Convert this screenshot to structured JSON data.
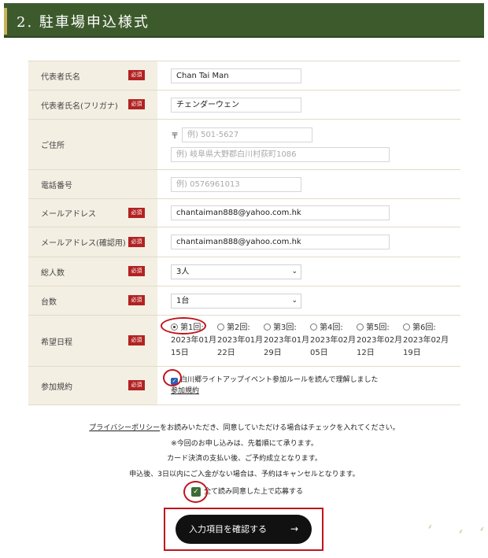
{
  "header": {
    "title": "2. 駐車場申込様式"
  },
  "required_badge": "必須",
  "rows": {
    "name": {
      "label": "代表者氏名",
      "value": "Chan Tai Man"
    },
    "furigana": {
      "label": "代表者氏名(フリガナ)",
      "value": "チェンダーウェン"
    },
    "address": {
      "label": "ご住所",
      "zip_mark": "〒",
      "zip_placeholder": "例) 501-5627",
      "addr_placeholder": "例) 岐阜県大野郡白川村荻町1086"
    },
    "phone": {
      "label": "電話番号",
      "placeholder": "例) 0576961013"
    },
    "email": {
      "label": "メールアドレス",
      "value": "chantaiman888@yahoo.com.hk"
    },
    "email_confirm": {
      "label": "メールアドレス(確認用)",
      "value": "chantaiman888@yahoo.com.hk"
    },
    "people": {
      "label": "総人数",
      "value": "3人"
    },
    "cars": {
      "label": "台数",
      "value": "1台"
    },
    "schedule": {
      "label": "希望日程",
      "options": [
        {
          "label": "第1回:",
          "date1": "2023年01月",
          "date2": "15日",
          "selected": true
        },
        {
          "label": "第2回:",
          "date1": "2023年01月",
          "date2": "22日",
          "selected": false
        },
        {
          "label": "第3回:",
          "date1": "2023年01月",
          "date2": "29日",
          "selected": false
        },
        {
          "label": "第4回:",
          "date1": "2023年02月",
          "date2": "05日",
          "selected": false
        },
        {
          "label": "第5回:",
          "date1": "2023年02月",
          "date2": "12日",
          "selected": false
        },
        {
          "label": "第6回:",
          "date1": "2023年02月",
          "date2": "19日",
          "selected": false
        }
      ]
    },
    "rules": {
      "label": "参加規約",
      "agree_text": "白川郷ライトアップイベント参加ルールを読んで理解しました",
      "link": "参加規約"
    }
  },
  "notes": {
    "privacy_link": "プライバシーポリシー",
    "line1_rest": "をお読みいただき、同意していただける場合はチェックを入れてください。",
    "line2": "※今回のお申し込みは、先着順にて承ります。",
    "line3": "カード決済の支払い後、ご予約成立となります。",
    "line4": "申込後、3日以内にご入金がない場合は、予約はキャンセルとなります。"
  },
  "confirm": {
    "text": "全て読み同意した上で応募する"
  },
  "submit": {
    "label": "入力項目を確認する",
    "arrow": "→"
  },
  "icons": {
    "checkmark": "✓",
    "chevron": "⌄"
  },
  "colors": {
    "header_bg": "#3d5a2c",
    "required": "#b22222",
    "annotation_red": "#c0141b",
    "label_bg": "#f4efe3"
  }
}
